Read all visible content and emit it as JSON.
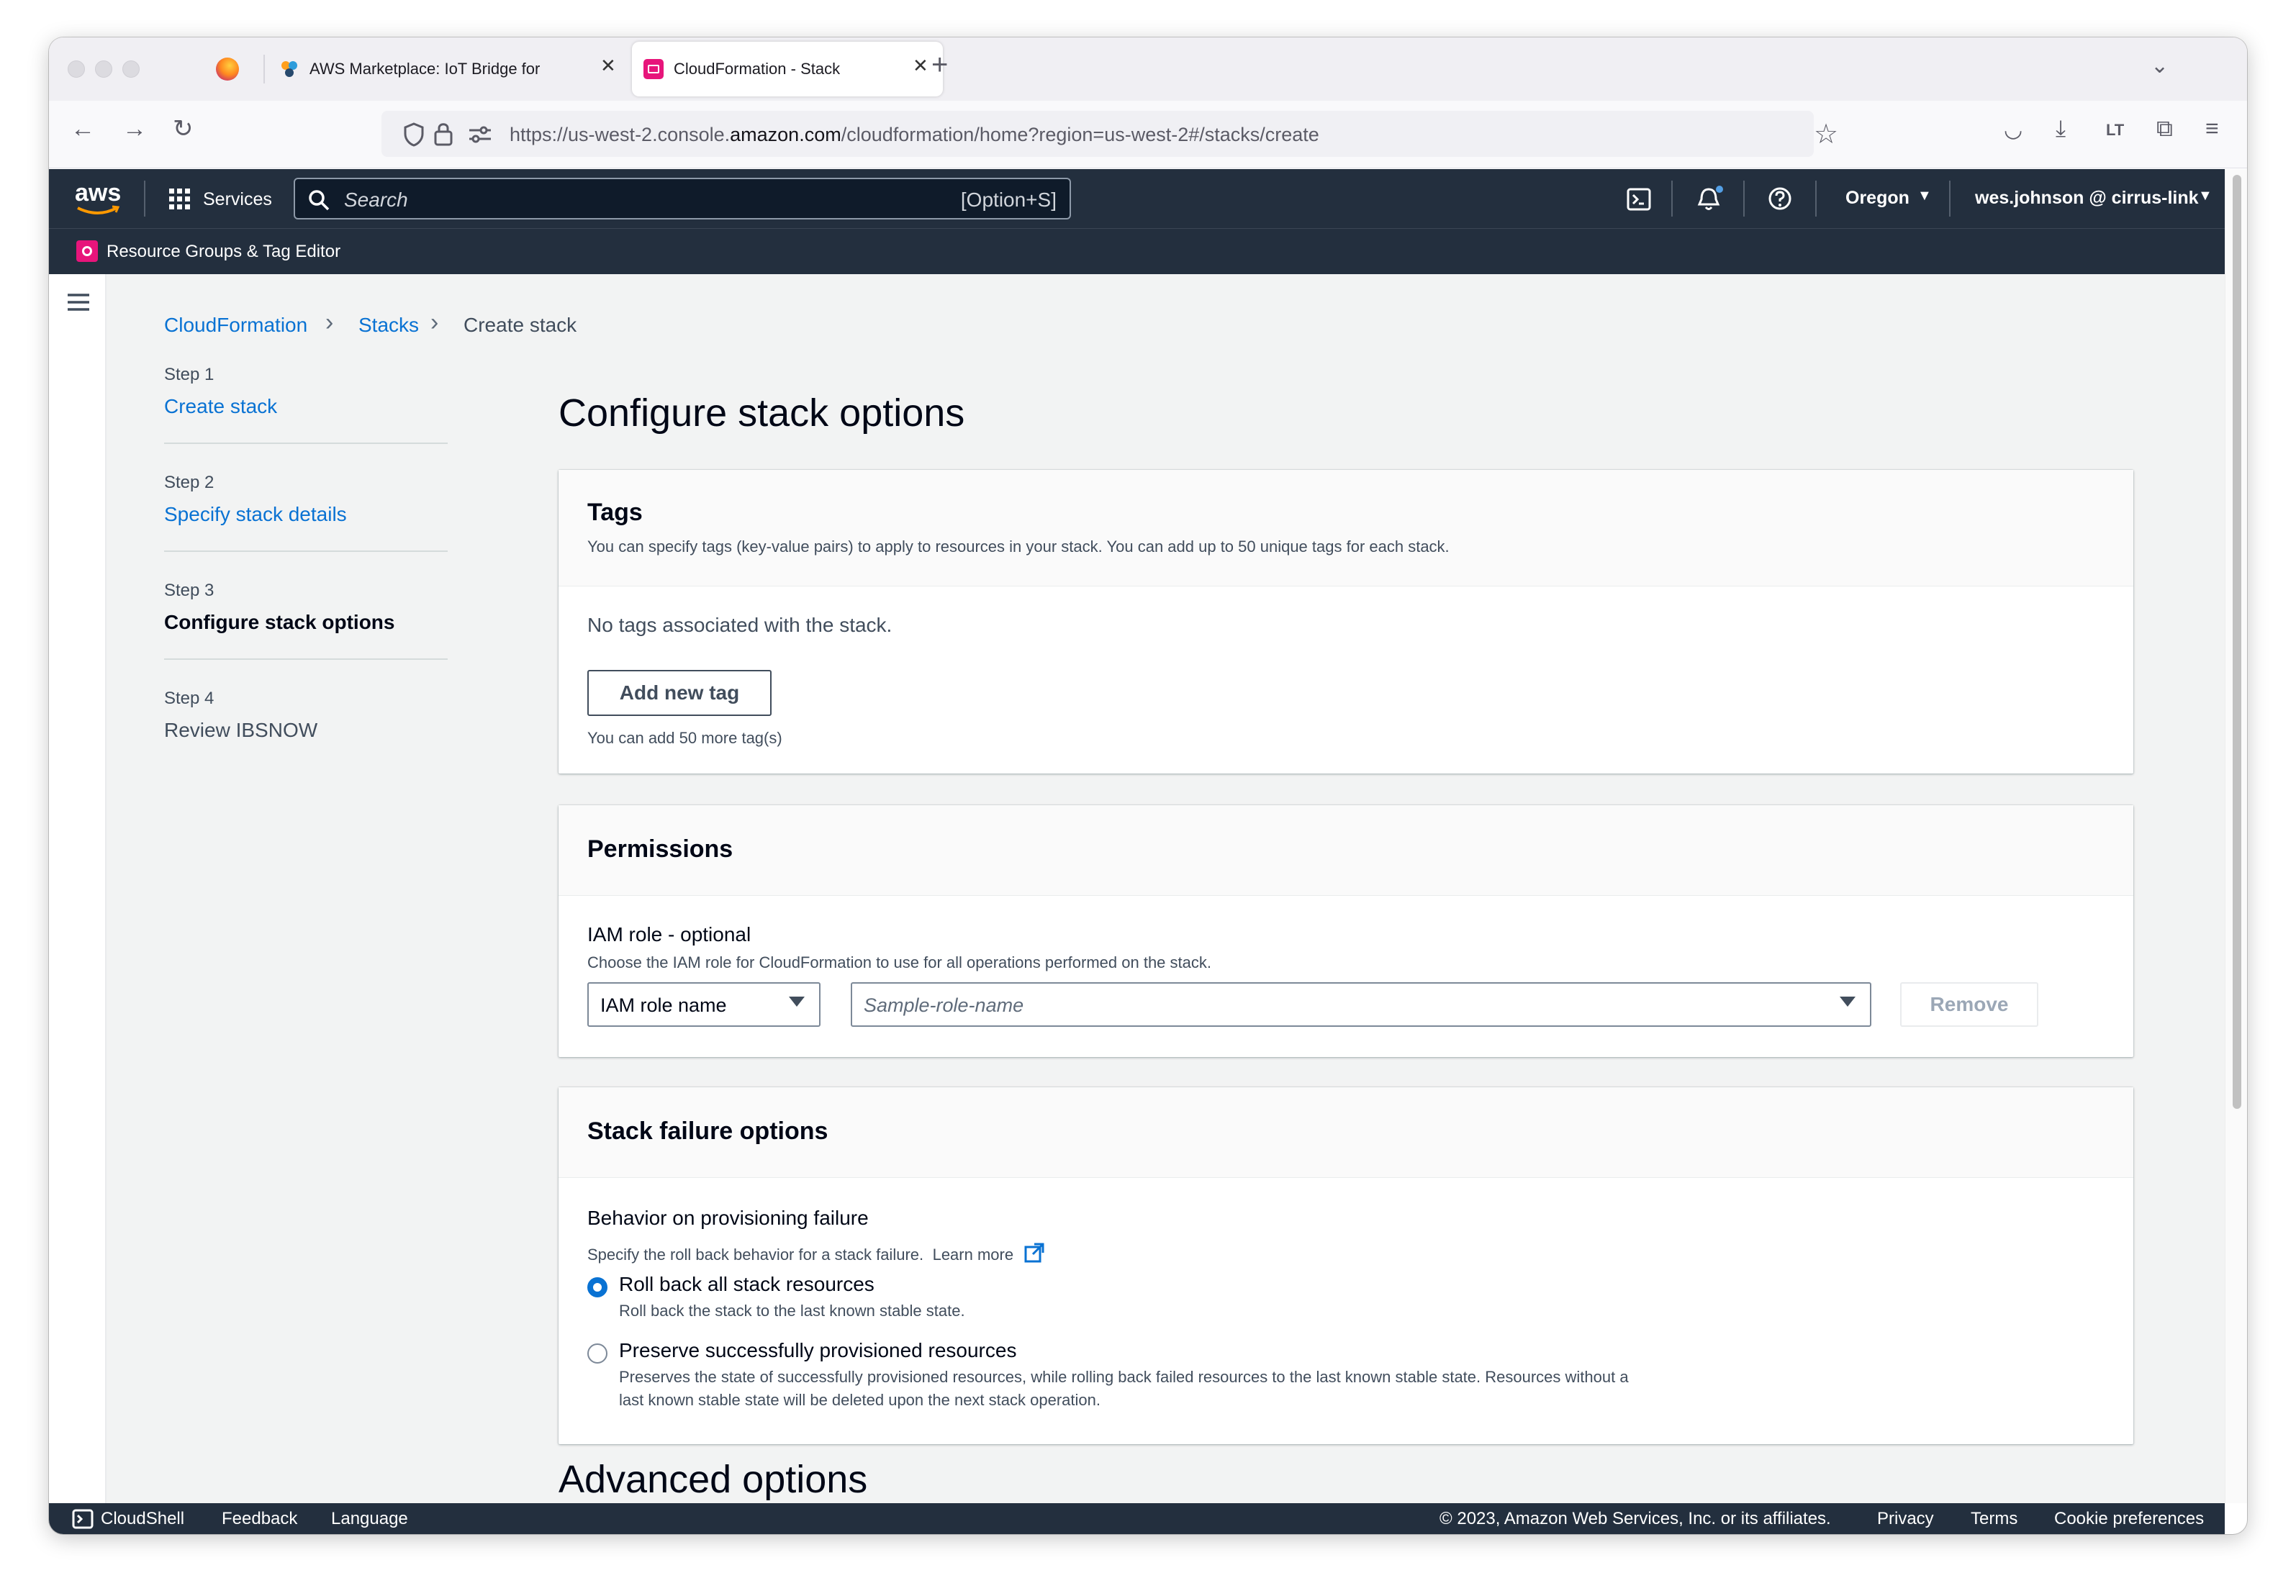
{
  "browser": {
    "tabs": [
      {
        "title": "AWS Marketplace: IoT Bridge for"
      },
      {
        "title": "CloudFormation - Stack"
      }
    ],
    "url_prefix": "https://us-west-2.console.",
    "url_domain": "amazon.com",
    "url_suffix": "/cloudformation/home?region=us-west-2#/stacks/create"
  },
  "aws_header": {
    "logo": "aws",
    "services": "Services",
    "search_placeholder": "Search",
    "search_shortcut": "[Option+S]",
    "region": "Oregon",
    "account": "wes.johnson @ cirrus-link",
    "favorite": "Resource Groups & Tag Editor"
  },
  "breadcrumb": [
    "CloudFormation",
    "Stacks",
    "Create stack"
  ],
  "steps": [
    {
      "label": "Step 1",
      "name": "Create stack"
    },
    {
      "label": "Step 2",
      "name": "Specify stack details"
    },
    {
      "label": "Step 3",
      "name": "Configure stack options"
    },
    {
      "label": "Step 4",
      "name": "Review IBSNOW"
    }
  ],
  "page_title": "Configure stack options",
  "tags": {
    "title": "Tags",
    "description": "You can specify tags (key-value pairs) to apply to resources in your stack. You can add up to 50 unique tags for each stack.",
    "empty": "No tags associated with the stack.",
    "add_button": "Add new tag",
    "hint": "You can add 50 more tag(s)"
  },
  "permissions": {
    "title": "Permissions",
    "label": "IAM role - optional",
    "description": "Choose the IAM role for CloudFormation to use for all operations performed on the stack.",
    "type_select": "IAM role name",
    "role_placeholder": "Sample-role-name",
    "remove": "Remove"
  },
  "failure": {
    "title": "Stack failure options",
    "label": "Behavior on provisioning failure",
    "description": "Specify the roll back behavior for a stack failure.",
    "learn_more": "Learn more",
    "options": [
      {
        "label": "Roll back all stack resources",
        "desc1": "Roll back the stack to the last known stable state.",
        "desc2": ""
      },
      {
        "label": "Preserve successfully provisioned resources",
        "desc1": "Preserves the state of successfully provisioned resources, while rolling back failed resources to the last known stable state. Resources without a",
        "desc2": "last known stable state will be deleted upon the next stack operation."
      }
    ],
    "selected": 0
  },
  "advanced_title": "Advanced options",
  "footer": {
    "cloudshell": "CloudShell",
    "feedback": "Feedback",
    "language": "Language",
    "copyright": "© 2023, Amazon Web Services, Inc. or its affiliates.",
    "privacy": "Privacy",
    "terms": "Terms",
    "cookies": "Cookie preferences"
  }
}
